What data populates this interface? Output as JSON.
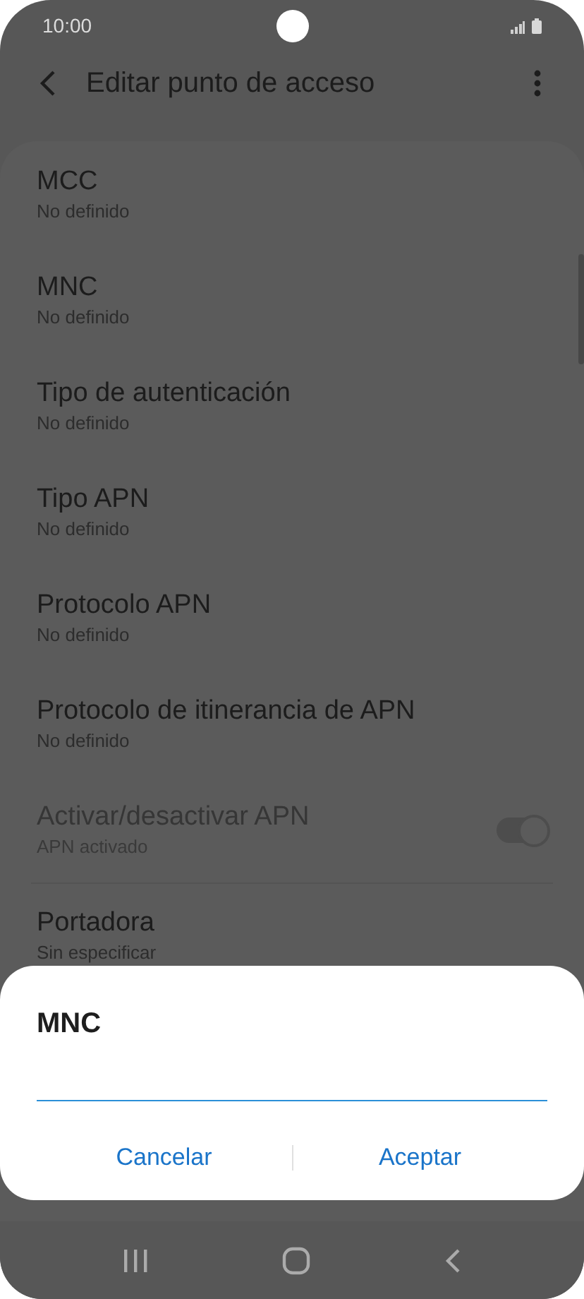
{
  "status_bar": {
    "time": "10:00"
  },
  "header": {
    "title": "Editar punto de acceso"
  },
  "items": [
    {
      "kind": "text",
      "title": "MCC",
      "subtitle": "No definido",
      "disabled": false
    },
    {
      "kind": "text",
      "title": "MNC",
      "subtitle": "No definido",
      "disabled": false
    },
    {
      "kind": "text",
      "title": "Tipo de autenticación",
      "subtitle": "No definido",
      "disabled": false
    },
    {
      "kind": "text",
      "title": "Tipo APN",
      "subtitle": "No definido",
      "disabled": false
    },
    {
      "kind": "text",
      "title": "Protocolo APN",
      "subtitle": "No definido",
      "disabled": false
    },
    {
      "kind": "text",
      "title": "Protocolo de itinerancia de APN",
      "subtitle": "No definido",
      "disabled": false
    },
    {
      "kind": "toggle",
      "title": "Activar/desactivar APN",
      "subtitle": "APN activado",
      "disabled": true,
      "on": true
    },
    {
      "kind": "text",
      "title": "Portadora",
      "subtitle": "Sin especificar",
      "disabled": false
    }
  ],
  "dialog": {
    "title": "MNC",
    "buttons": [
      "Cancelar",
      "Aceptar"
    ]
  }
}
